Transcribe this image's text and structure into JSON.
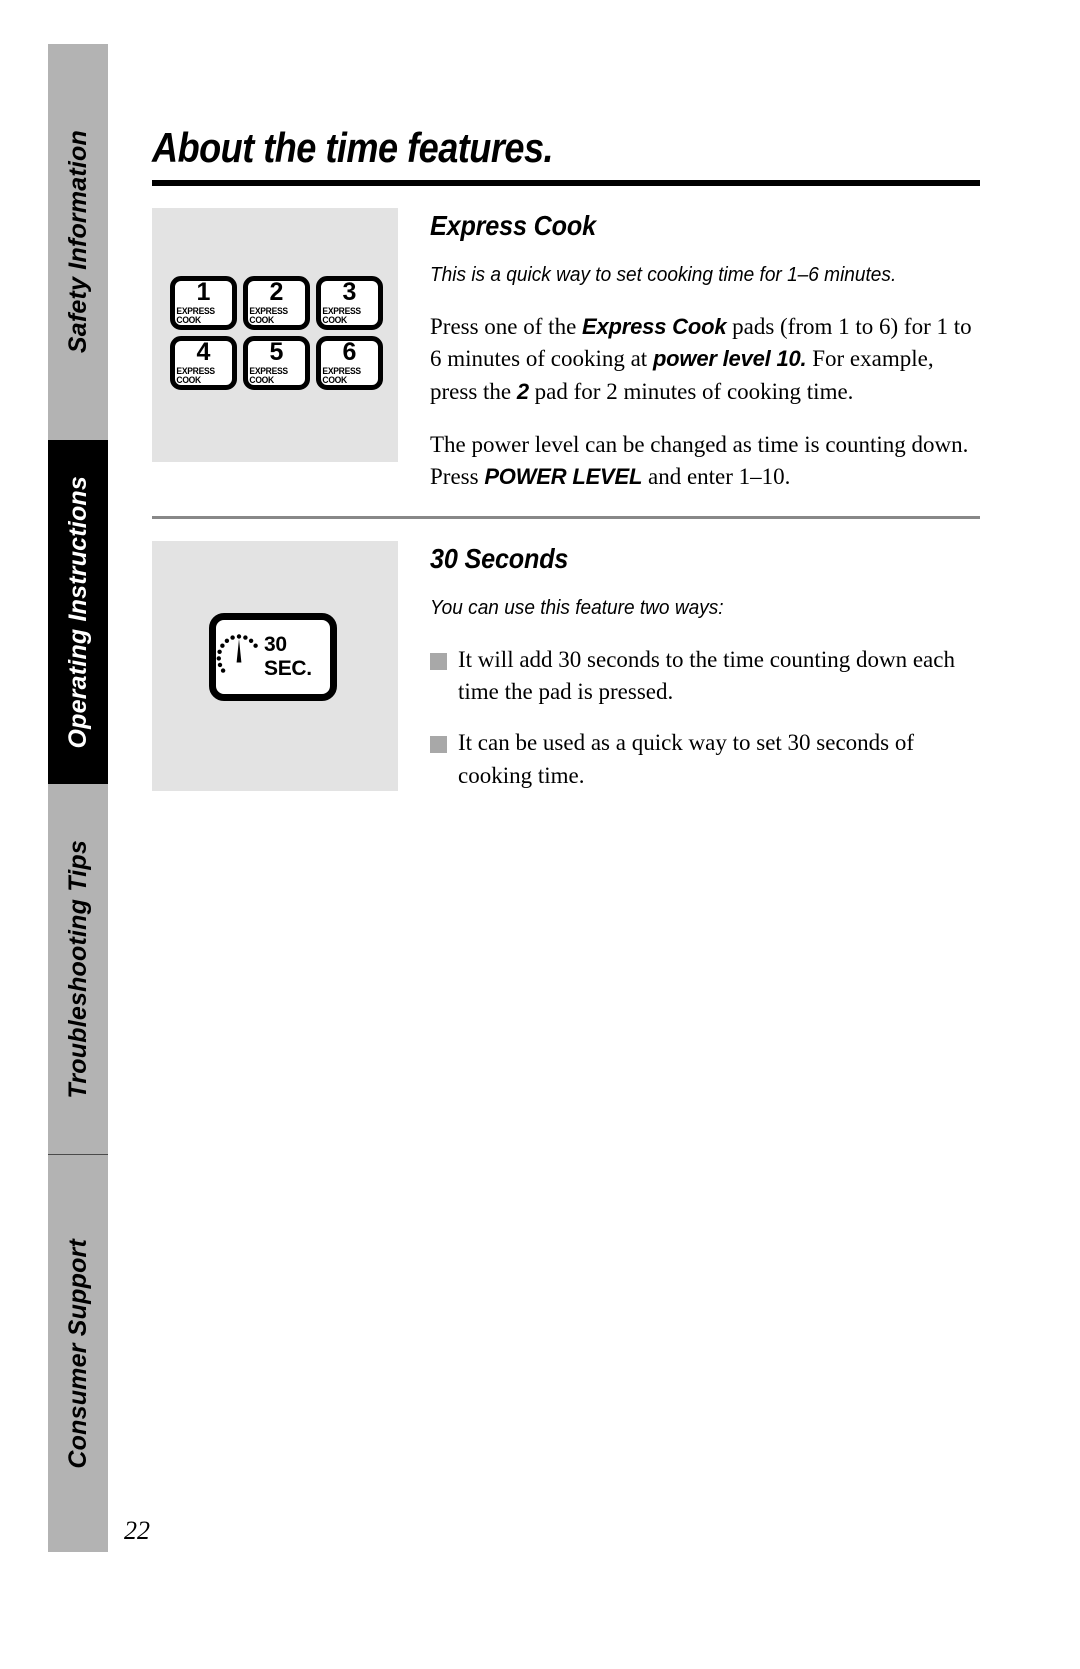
{
  "page": {
    "title": "About the time features.",
    "number": "22"
  },
  "sidebar": {
    "tabs": [
      {
        "label": "Safety Information",
        "style": "gray"
      },
      {
        "label": "Operating Instructions",
        "style": "black"
      },
      {
        "label": "Troubleshooting Tips",
        "style": "gray"
      },
      {
        "label": "Consumer Support",
        "style": "gray"
      }
    ]
  },
  "sections": [
    {
      "heading": "Express Cook",
      "intro": "This is a quick way to set cooking time for 1–6 minutes.",
      "paragraphs": [
        {
          "parts": [
            {
              "t": "Press one of the ",
              "b": false
            },
            {
              "t": "Express Cook",
              "b": true
            },
            {
              "t": " pads (from 1 to 6) for 1 to 6 minutes of cooking at ",
              "b": false
            },
            {
              "t": "power level 10.",
              "b": true
            },
            {
              "t": " For example, press the ",
              "b": false
            },
            {
              "t": "2",
              "b": true
            },
            {
              "t": " pad for 2 minutes of cooking time.",
              "b": false
            }
          ]
        },
        {
          "parts": [
            {
              "t": "The power level can be changed as time is counting down. Press ",
              "b": false
            },
            {
              "t": "POWER LEVEL",
              "b": true
            },
            {
              "t": " and enter 1–10.",
              "b": false
            }
          ]
        }
      ],
      "bullets": [],
      "figure": {
        "type": "express-cook-keypad",
        "keys": [
          {
            "number": "1",
            "sublabel": "EXPRESS COOK"
          },
          {
            "number": "2",
            "sublabel": "EXPRESS COOK"
          },
          {
            "number": "3",
            "sublabel": "EXPRESS COOK"
          },
          {
            "number": "4",
            "sublabel": "EXPRESS COOK"
          },
          {
            "number": "5",
            "sublabel": "EXPRESS COOK"
          },
          {
            "number": "6",
            "sublabel": "EXPRESS COOK"
          }
        ]
      }
    },
    {
      "heading": "30 Seconds",
      "intro": "You can use this feature two ways:",
      "paragraphs": [],
      "bullets": [
        {
          "text": "It will add 30 seconds to the time counting down each time the pad is pressed."
        },
        {
          "text": "It can be used as a quick way to set 30 seconds of cooking time."
        }
      ],
      "figure": {
        "type": "thirty-second-pad",
        "pad_label": "30 SEC.",
        "icon": "timer-icon"
      }
    }
  ],
  "colors": {
    "tab_gray": "#b3b3b3",
    "tab_black": "#000000",
    "figure_background": "#e3e3e3",
    "bullet_gray": "#a8a8a8",
    "rule_gray": "#888888"
  }
}
